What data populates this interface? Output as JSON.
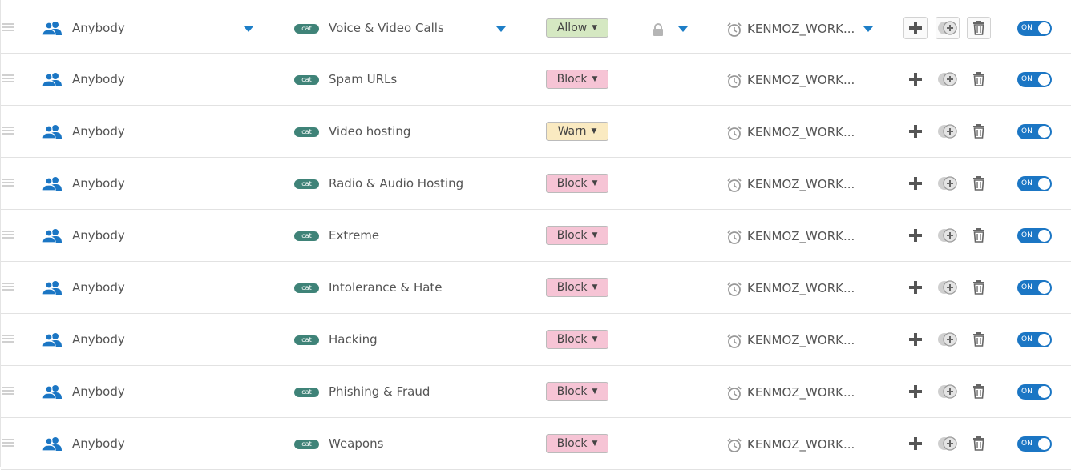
{
  "colors": {
    "accent": "#1b76c4",
    "cat_badge": "#3f8378",
    "allow": "#d5e8c2",
    "block": "#f6c4d5",
    "warn": "#faeac1"
  },
  "icons": {
    "drag": "drag-handle-icon",
    "users": "users-icon",
    "lock": "lock-icon",
    "clock": "alarm-clock-icon",
    "add": "plus-icon",
    "clone": "clone-icon",
    "delete": "trash-icon"
  },
  "rules": [
    {
      "who": "Anybody",
      "cat_badge": "cat",
      "category": "Voice & Video Calls",
      "action": "Allow",
      "action_color": "#d5e8c2",
      "schedule": "KENMOZ_WORK...",
      "toggle": "ON",
      "expanded": true
    },
    {
      "who": "Anybody",
      "cat_badge": "cat",
      "category": "Spam URLs",
      "action": "Block",
      "action_color": "#f6c4d5",
      "schedule": "KENMOZ_WORK...",
      "toggle": "ON",
      "expanded": false
    },
    {
      "who": "Anybody",
      "cat_badge": "cat",
      "category": "Video hosting",
      "action": "Warn",
      "action_color": "#faeac1",
      "schedule": "KENMOZ_WORK...",
      "toggle": "ON",
      "expanded": false
    },
    {
      "who": "Anybody",
      "cat_badge": "cat",
      "category": "Radio & Audio Hosting",
      "action": "Block",
      "action_color": "#f6c4d5",
      "schedule": "KENMOZ_WORK...",
      "toggle": "ON",
      "expanded": false
    },
    {
      "who": "Anybody",
      "cat_badge": "cat",
      "category": "Extreme",
      "action": "Block",
      "action_color": "#f6c4d5",
      "schedule": "KENMOZ_WORK...",
      "toggle": "ON",
      "expanded": false
    },
    {
      "who": "Anybody",
      "cat_badge": "cat",
      "category": "Intolerance & Hate",
      "action": "Block",
      "action_color": "#f6c4d5",
      "schedule": "KENMOZ_WORK...",
      "toggle": "ON",
      "expanded": false
    },
    {
      "who": "Anybody",
      "cat_badge": "cat",
      "category": "Hacking",
      "action": "Block",
      "action_color": "#f6c4d5",
      "schedule": "KENMOZ_WORK...",
      "toggle": "ON",
      "expanded": false
    },
    {
      "who": "Anybody",
      "cat_badge": "cat",
      "category": "Phishing & Fraud",
      "action": "Block",
      "action_color": "#f6c4d5",
      "schedule": "KENMOZ_WORK...",
      "toggle": "ON",
      "expanded": false
    },
    {
      "who": "Anybody",
      "cat_badge": "cat",
      "category": "Weapons",
      "action": "Block",
      "action_color": "#f6c4d5",
      "schedule": "KENMOZ_WORK...",
      "toggle": "ON",
      "expanded": false
    }
  ]
}
